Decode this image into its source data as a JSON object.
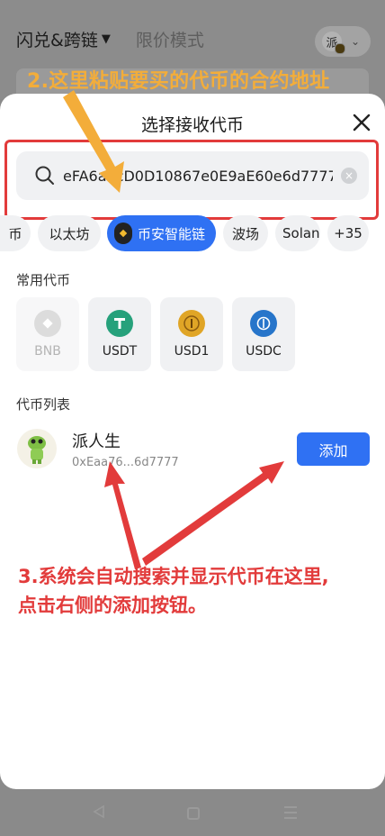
{
  "header": {
    "tabs": [
      {
        "label": "闪兑&跨链",
        "active": true
      },
      {
        "label": "限价模式",
        "active": false
      }
    ],
    "account_label": "派"
  },
  "annotations": {
    "step2": "2.这里粘贴要买的代币的合约地址",
    "step3_line1": "3.系统会自动搜索并显示代币在这里,",
    "step3_line2": "点击右侧的添加按钮。",
    "color": "#e23b3b",
    "step2_color": "#f3ad3a"
  },
  "sheet": {
    "title": "选择接收代币",
    "search_value": "eFA6a3cD0D10867e0E9aE60e6d7777",
    "chains": [
      "币",
      "以太坊",
      "币安智能链",
      "波场",
      "Solan",
      "+35"
    ],
    "active_chain": "币安智能链",
    "common_label": "常用代币",
    "common_tokens": [
      {
        "symbol": "BNB",
        "icon": "bnb-icon",
        "disabled": true
      },
      {
        "symbol": "USDT",
        "icon": "usdt-icon",
        "disabled": false
      },
      {
        "symbol": "USD1",
        "icon": "usd1-icon",
        "disabled": false
      },
      {
        "symbol": "USDC",
        "icon": "usdc-icon",
        "disabled": false
      }
    ],
    "list_label": "代币列表",
    "token": {
      "name": "派人生",
      "address": "0xEaa76...6d7777",
      "icon": "frog-mascot-icon"
    },
    "add_label": "添加"
  },
  "colors": {
    "accent": "#2f71f3",
    "highlight_red": "#e23b3b"
  }
}
